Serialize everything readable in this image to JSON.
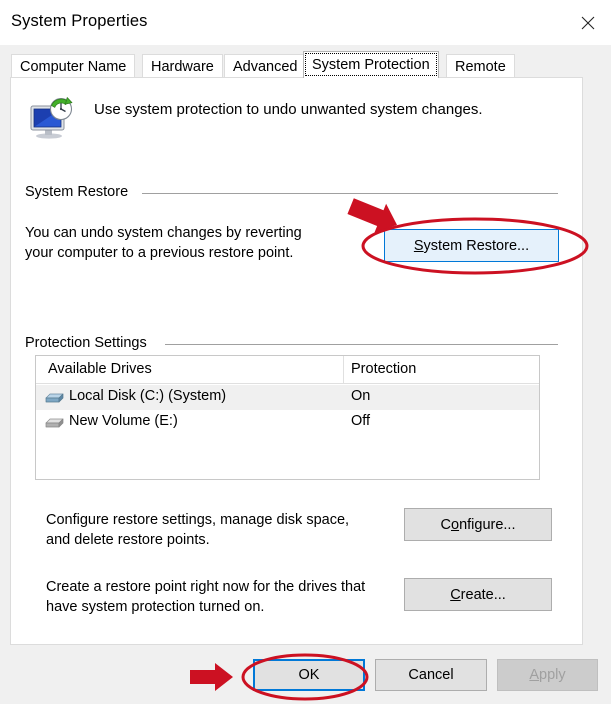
{
  "window": {
    "title": "System Properties",
    "close_icon": "close-icon"
  },
  "tabs": [
    {
      "label": "Computer Name",
      "selected": false
    },
    {
      "label": "Hardware",
      "selected": false
    },
    {
      "label": "Advanced",
      "selected": false
    },
    {
      "label": "System Protection",
      "selected": true
    },
    {
      "label": "Remote",
      "selected": false
    }
  ],
  "header": {
    "icon": "system-protection-icon",
    "caption": "Use system protection to undo unwanted system changes."
  },
  "system_restore": {
    "group_label": "System Restore",
    "description_line1": "You can undo system changes by reverting",
    "description_line2": "your computer to a previous restore point.",
    "button_label": "System Restore...",
    "button_accel": "S",
    "button_rest": "ystem Restore..."
  },
  "protection_settings": {
    "group_label": "Protection Settings",
    "columns": [
      "Available Drives",
      "Protection"
    ],
    "rows": [
      {
        "icon": "hard-drive-icon-system",
        "name": "Local Disk (C:) (System)",
        "protection": "On",
        "selected": true
      },
      {
        "icon": "hard-drive-icon",
        "name": "New Volume (E:)",
        "protection": "Off",
        "selected": false
      }
    ],
    "configure": {
      "description_line1": "Configure restore settings, manage disk space,",
      "description_line2": "and delete restore points.",
      "button_accel_pre": "C",
      "button_accel": "o",
      "button_rest": "nfigure..."
    },
    "create": {
      "description_line1": "Create a restore point right now for the drives that",
      "description_line2": "have system protection turned on.",
      "button_accel": "C",
      "button_rest": "reate..."
    }
  },
  "footer": {
    "ok_label": "OK",
    "cancel_label": "Cancel",
    "apply_accel": "A",
    "apply_rest": "pply",
    "apply_disabled": true
  },
  "annotations": {
    "color": "#cc1122",
    "arrow_system_restore": "red-arrow-pointing-to-system-restore-button",
    "ellipse_system_restore": "red-ellipse-around-system-restore-button",
    "arrow_ok": "red-arrow-pointing-to-ok-button",
    "ellipse_ok": "red-ellipse-around-ok-button"
  },
  "colors": {
    "accent": "#0078d7",
    "button_face": "#e1e1e1",
    "hover_fill": "#e5f1fb",
    "annotation_red": "#cc1122"
  }
}
